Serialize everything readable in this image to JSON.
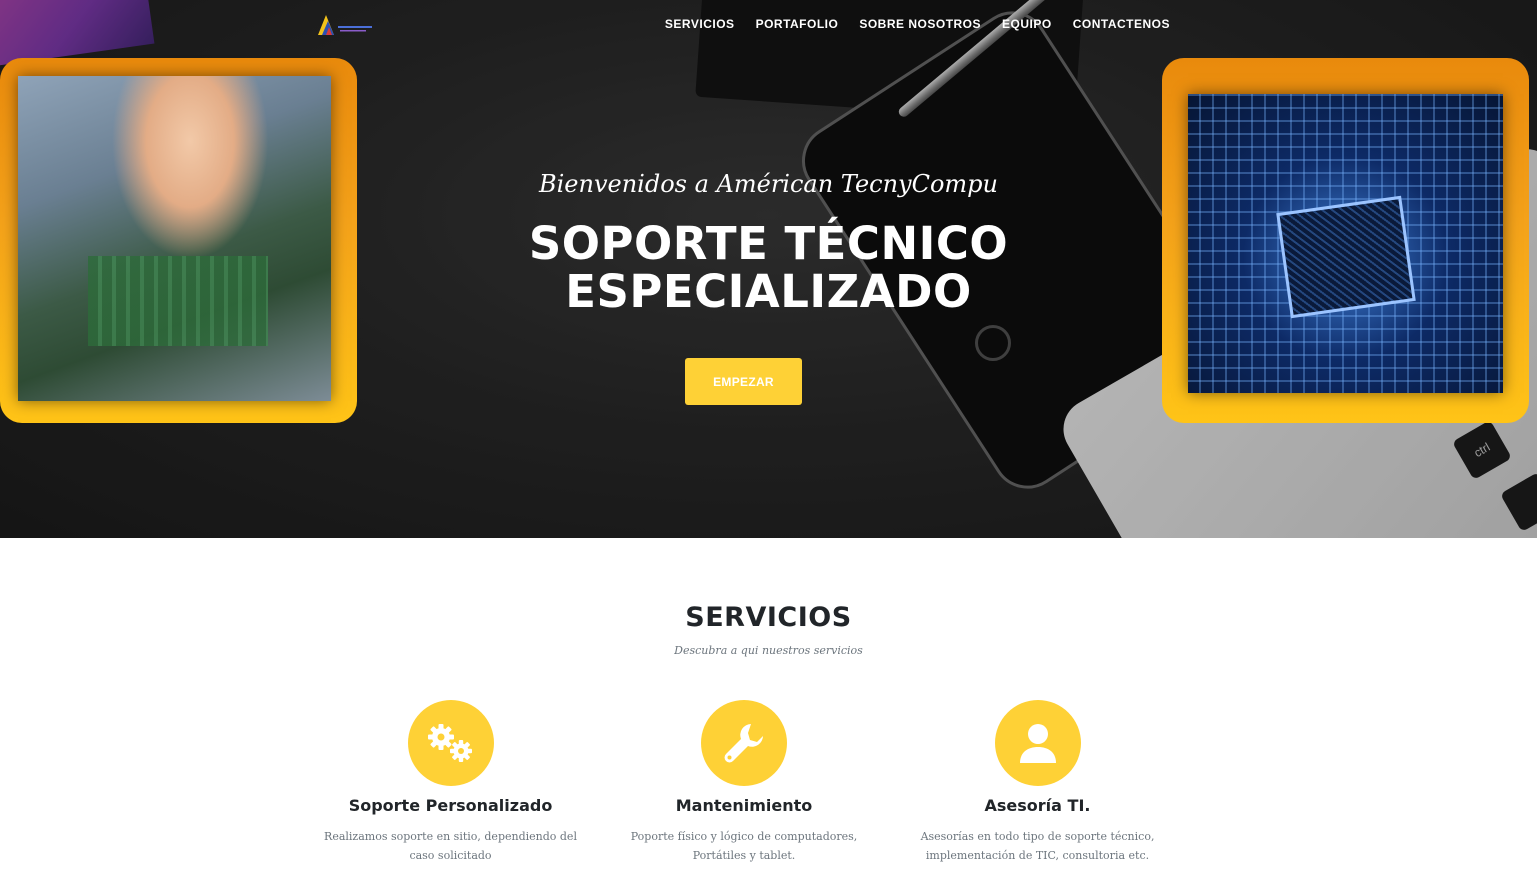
{
  "nav": {
    "items": [
      "SERVICIOS",
      "PORTAFOLIO",
      "SOBRE NOSOTROS",
      "EQUIPO",
      "CONTACTENOS"
    ]
  },
  "hero": {
    "subtitle": "Bienvenidos a Américan TecnyCompu",
    "title_line1": "SOPORTE TÉCNICO",
    "title_line2": "ESPECIALIZADO",
    "cta_label": "EMPEZAR",
    "keyboard_key": "ctrl"
  },
  "services": {
    "heading": "SERVICIOS",
    "subheading": "Descubra a qui nuestros servicios",
    "items": [
      {
        "icon": "gears-icon",
        "title": "Soporte Personalizado",
        "description": "Realizamos soporte en sitio, dependiendo del caso solicitado"
      },
      {
        "icon": "wrench-icon",
        "title": "Mantenimiento",
        "description": "Poporte físico y lógico de computadores, Portátiles y tablet."
      },
      {
        "icon": "user-icon",
        "title": "Asesoría TI.",
        "description": "Asesorías en todo tipo de soporte técnico, implementación de TIC, consultoria etc."
      }
    ]
  },
  "colors": {
    "accent": "#fed136",
    "frame_top": "#e98a0c",
    "frame_bottom": "#ffc417",
    "heading": "#212529",
    "muted": "#6c757d"
  }
}
